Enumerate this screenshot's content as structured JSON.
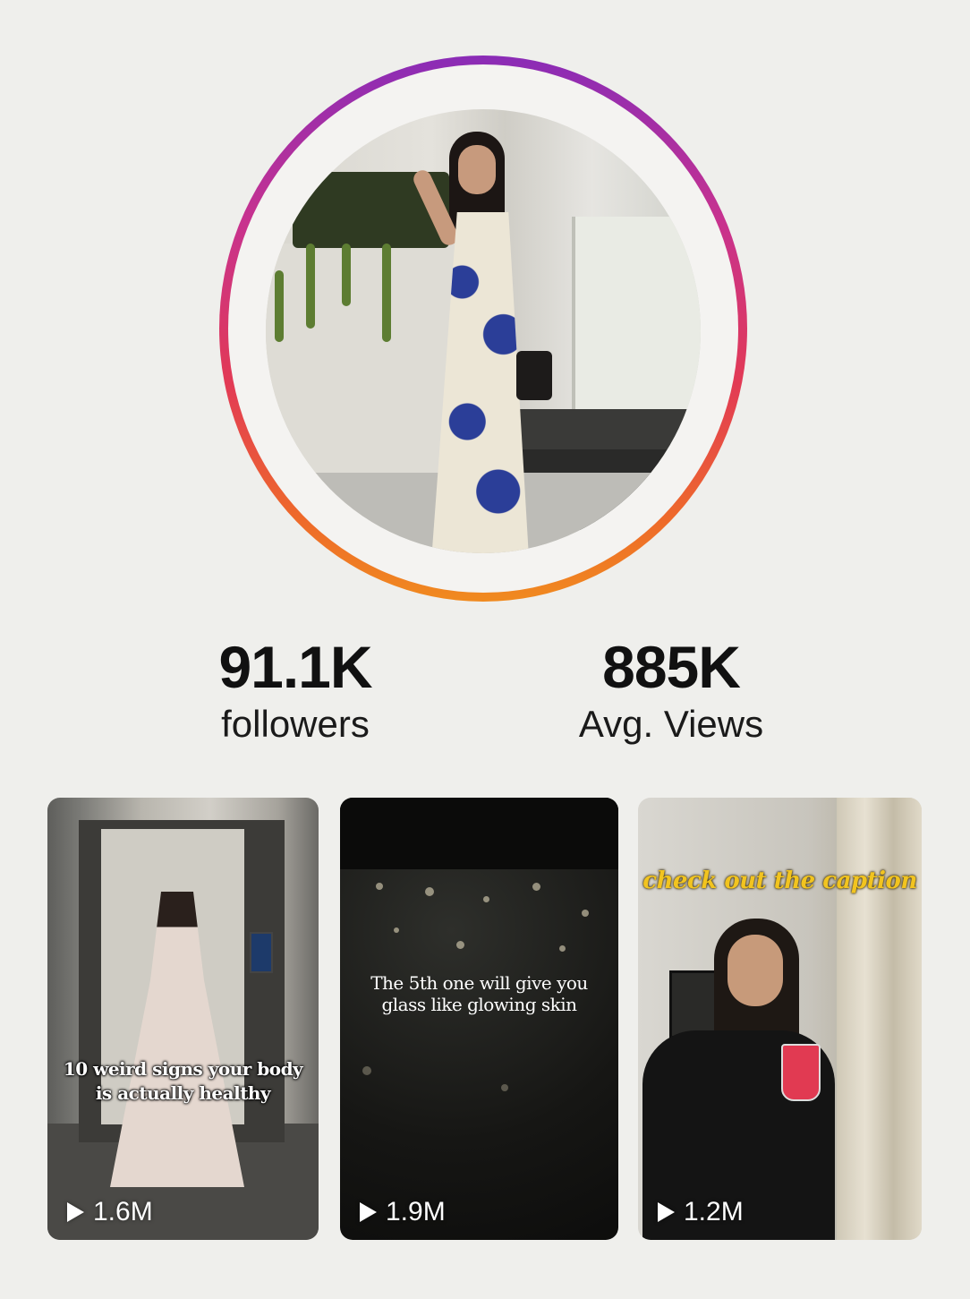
{
  "profile": {
    "photo_alt": "profile-photo",
    "ring_colors": [
      "#8a2cb6",
      "#c7328f",
      "#e23a55",
      "#ee6a2a",
      "#f08a1f"
    ]
  },
  "stats": {
    "followers": {
      "value": "91.1K",
      "label": "followers"
    },
    "avg_views": {
      "value": "885K",
      "label": "Avg. Views"
    }
  },
  "reels": [
    {
      "overlay_line1": "10 weird signs your body",
      "overlay_line2": "is actually healthy",
      "views": "1.6M",
      "icon": "play-icon"
    },
    {
      "overlay_line1": "The 5th one will give you",
      "overlay_line2": "glass like glowing skin",
      "views": "1.9M",
      "icon": "play-icon"
    },
    {
      "caption_tag": "check out the caption",
      "views": "1.2M",
      "icon": "play-icon"
    }
  ],
  "colors": {
    "background": "#efefec",
    "caption_yellow": "#f2c41f",
    "text": "#111111"
  }
}
